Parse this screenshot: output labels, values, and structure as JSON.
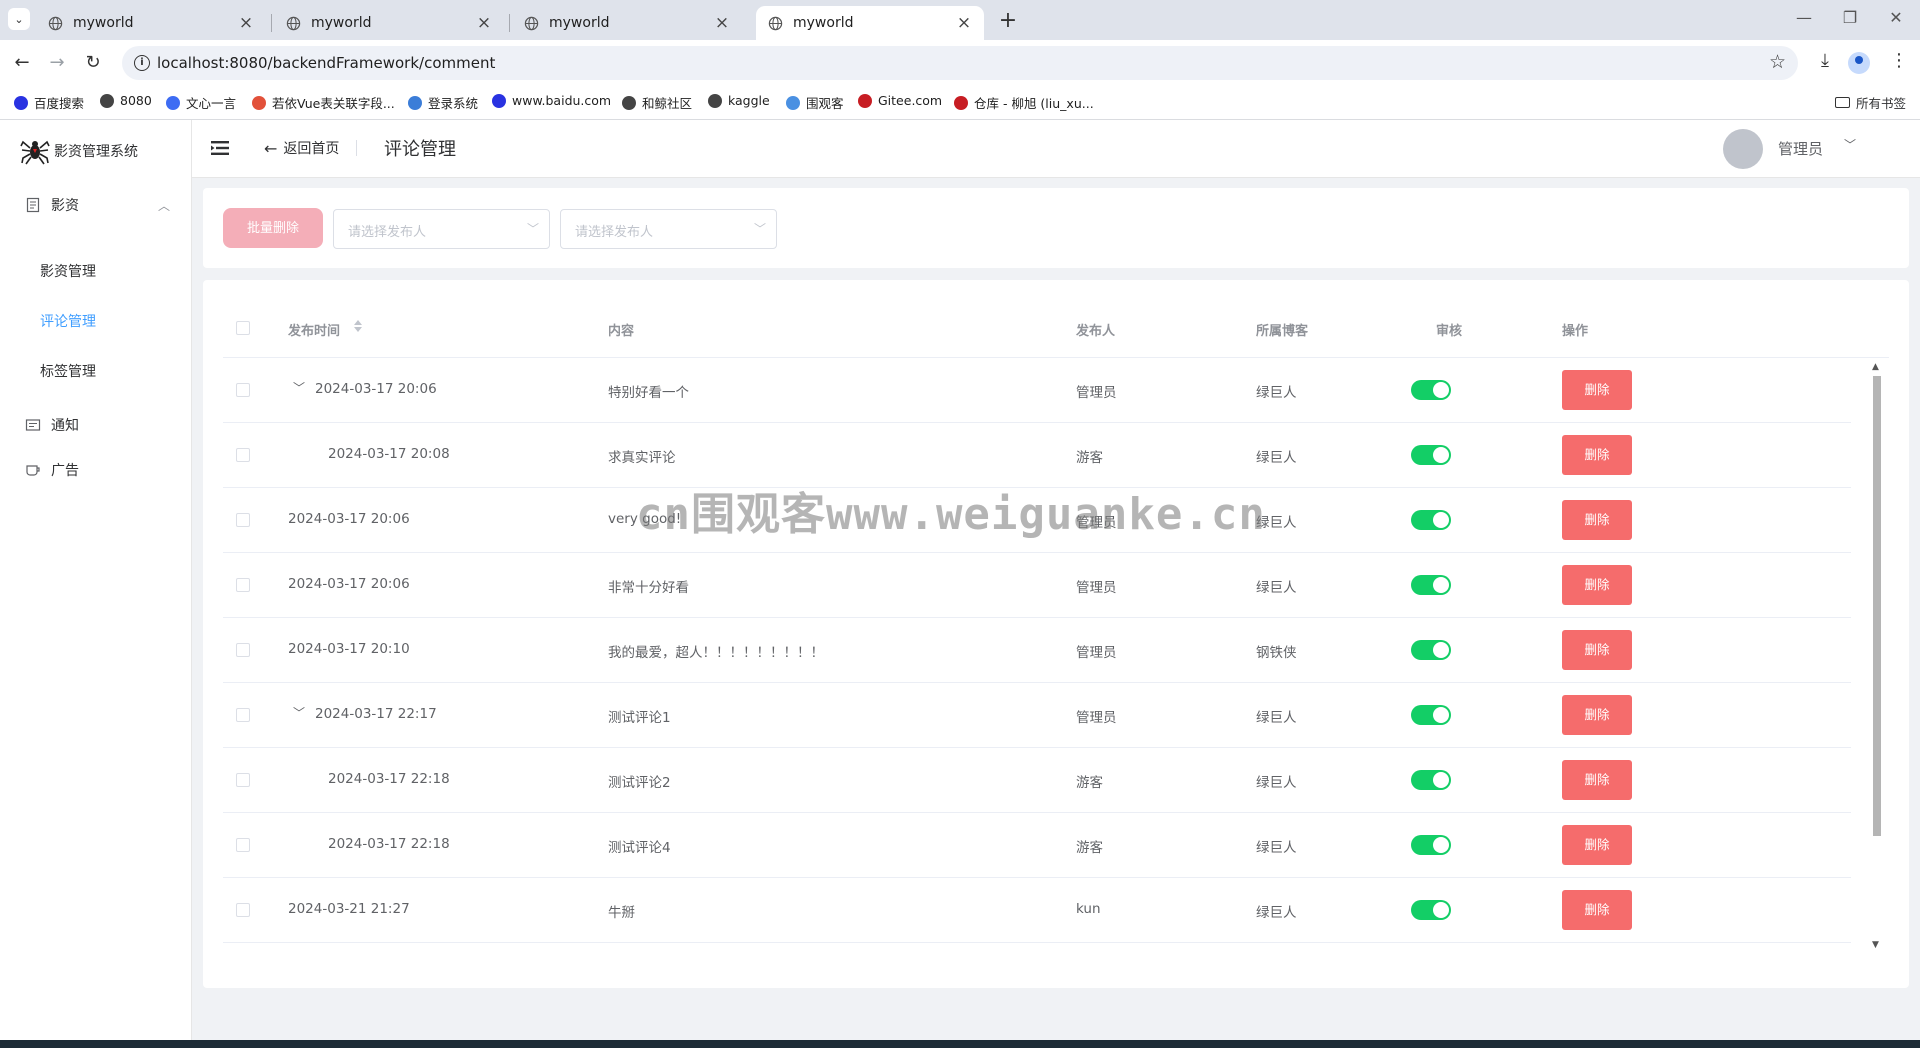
{
  "browser": {
    "tabs": [
      {
        "title": "myworld",
        "active": false
      },
      {
        "title": "myworld",
        "active": false
      },
      {
        "title": "myworld",
        "active": false
      },
      {
        "title": "myworld",
        "active": true
      }
    ],
    "new_tab": "+",
    "url": "localhost:8080/backendFramework/comment",
    "bookmarks": [
      {
        "label": "百度搜索",
        "color": "#2932e1"
      },
      {
        "label": "8080",
        "color": "#444444"
      },
      {
        "label": "文心一言",
        "color": "#3d6cf3"
      },
      {
        "label": "若依Vue表关联字段...",
        "color": "#e2513a"
      },
      {
        "label": "登录系统",
        "color": "#3b7dd8"
      },
      {
        "label": "www.baidu.com",
        "color": "#2932e1"
      },
      {
        "label": "和鲸社区",
        "color": "#444444"
      },
      {
        "label": "kaggle",
        "color": "#444444"
      },
      {
        "label": "围观客",
        "color": "#4a90e2"
      },
      {
        "label": "Gitee.com",
        "color": "#c71d23"
      },
      {
        "label": "仓库 - 柳旭 (liu_xu...",
        "color": "#c71d23"
      }
    ],
    "all_bookmarks": "所有书签"
  },
  "sidebar": {
    "logo_text": "影资管理系统",
    "group_label": "影资",
    "items": [
      {
        "label": "影资管理",
        "active": false
      },
      {
        "label": "评论管理",
        "active": true
      },
      {
        "label": "标签管理",
        "active": false
      }
    ],
    "notice_label": "通知",
    "ad_label": "广告"
  },
  "header": {
    "back_label": "返回首页",
    "title": "评论管理",
    "user_name": "管理员"
  },
  "filters": {
    "batch_delete_label": "批量删除",
    "select1_placeholder": "请选择发布人",
    "select2_placeholder": "请选择发布人"
  },
  "table": {
    "columns": {
      "time": "发布时间",
      "content": "内容",
      "author": "发布人",
      "blog": "所属博客",
      "review": "审核",
      "actions": "操作"
    },
    "delete_label": "删除",
    "rows": [
      {
        "time": "2024-03-17 20:06",
        "content": "特别好看一个",
        "author": "管理员",
        "blog": "绿巨人",
        "level": 0,
        "expandable": true,
        "approved": true
      },
      {
        "time": "2024-03-17 20:08",
        "content": "求真实评论",
        "author": "游客",
        "blog": "绿巨人",
        "level": 1,
        "expandable": false,
        "approved": true
      },
      {
        "time": "2024-03-17 20:06",
        "content": "very good!",
        "author": "管理员",
        "blog": "绿巨人",
        "level": 0,
        "expandable": false,
        "approved": true
      },
      {
        "time": "2024-03-17 20:06",
        "content": "非常十分好看",
        "author": "管理员",
        "blog": "绿巨人",
        "level": 0,
        "expandable": false,
        "approved": true
      },
      {
        "time": "2024-03-17 20:10",
        "content": "我的最爱，超人！！！！！！！！！",
        "author": "管理员",
        "blog": "钢铁侠",
        "level": 0,
        "expandable": false,
        "approved": true
      },
      {
        "time": "2024-03-17 22:17",
        "content": "测试评论1",
        "author": "管理员",
        "blog": "绿巨人",
        "level": 0,
        "expandable": true,
        "approved": true
      },
      {
        "time": "2024-03-17 22:18",
        "content": "测试评论2",
        "author": "游客",
        "blog": "绿巨人",
        "level": 1,
        "expandable": false,
        "approved": true
      },
      {
        "time": "2024-03-17 22:18",
        "content": "测试评论4",
        "author": "游客",
        "blog": "绿巨人",
        "level": 1,
        "expandable": false,
        "approved": true
      },
      {
        "time": "2024-03-21 21:27",
        "content": "牛掰",
        "author": "kun",
        "blog": "绿巨人",
        "level": 0,
        "expandable": false,
        "approved": true
      }
    ]
  },
  "watermark": "cn围观客www.weiguanke.cn",
  "colors": {
    "accent": "#409eff",
    "danger": "#f56c6c",
    "danger_disabled": "#f4aeb8",
    "switch_on": "#13ce66"
  }
}
